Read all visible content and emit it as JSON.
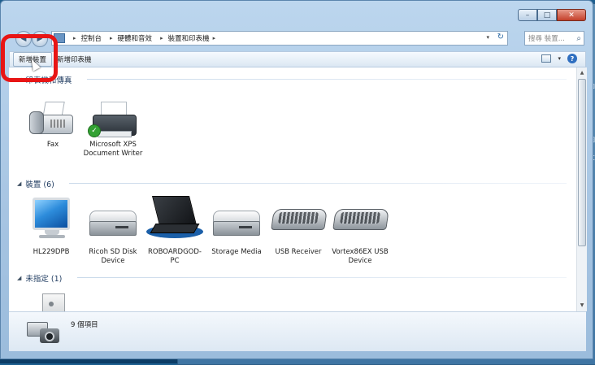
{
  "window": {
    "caption_min": "–",
    "caption_max": "□",
    "caption_close": "✕"
  },
  "nav": {
    "back": "◀",
    "forward": "▶"
  },
  "address": {
    "crumbs": [
      "控制台",
      "硬體和音效",
      "裝置和印表機"
    ],
    "separator": "▸",
    "dropdown": "▾",
    "refresh": "↻"
  },
  "search": {
    "placeholder": "搜尋 裝置..."
  },
  "toolbar": {
    "add_device": "新增裝置",
    "add_printer": "新增印表機",
    "dropdown": "▾",
    "help": "?"
  },
  "groups": {
    "printers": {
      "title": "印表機和傳真",
      "expand": "◢"
    },
    "devices": {
      "title": "裝置 (6)",
      "expand": "◢"
    },
    "unspecified": {
      "title": "未指定 (1)",
      "expand": "◢"
    }
  },
  "printers": [
    {
      "label": "Fax",
      "icon": "fax-icon"
    },
    {
      "label": "Microsoft XPS Document Writer",
      "icon": "printer-icon",
      "default_check": "✓"
    }
  ],
  "devices": [
    {
      "label": "HL229DPB",
      "icon": "monitor-icon"
    },
    {
      "label": "Ricoh SD Disk Device",
      "icon": "drive-box-icon"
    },
    {
      "label": "ROBOARDGOD-PC",
      "icon": "laptop-icon"
    },
    {
      "label": "Storage Media",
      "icon": "drive-box-icon"
    },
    {
      "label": "USB Receiver",
      "icon": "keyboard-icon"
    },
    {
      "label": "Vortex86EX USB Device",
      "icon": "keyboard-icon"
    }
  ],
  "unspecified": [
    {
      "label": "",
      "icon": "tower-icon"
    }
  ],
  "scrollbar": {
    "up": "▲",
    "down": "▼"
  },
  "details": {
    "count": "9 個項目"
  },
  "background_glyphs": [
    "⊐",
    "f",
    "E",
    "⊟",
    "⊏",
    "⊐",
    "⊓",
    "⊔"
  ],
  "colors": {
    "annotation": "#e81515",
    "accent": "#2f6fc0"
  }
}
